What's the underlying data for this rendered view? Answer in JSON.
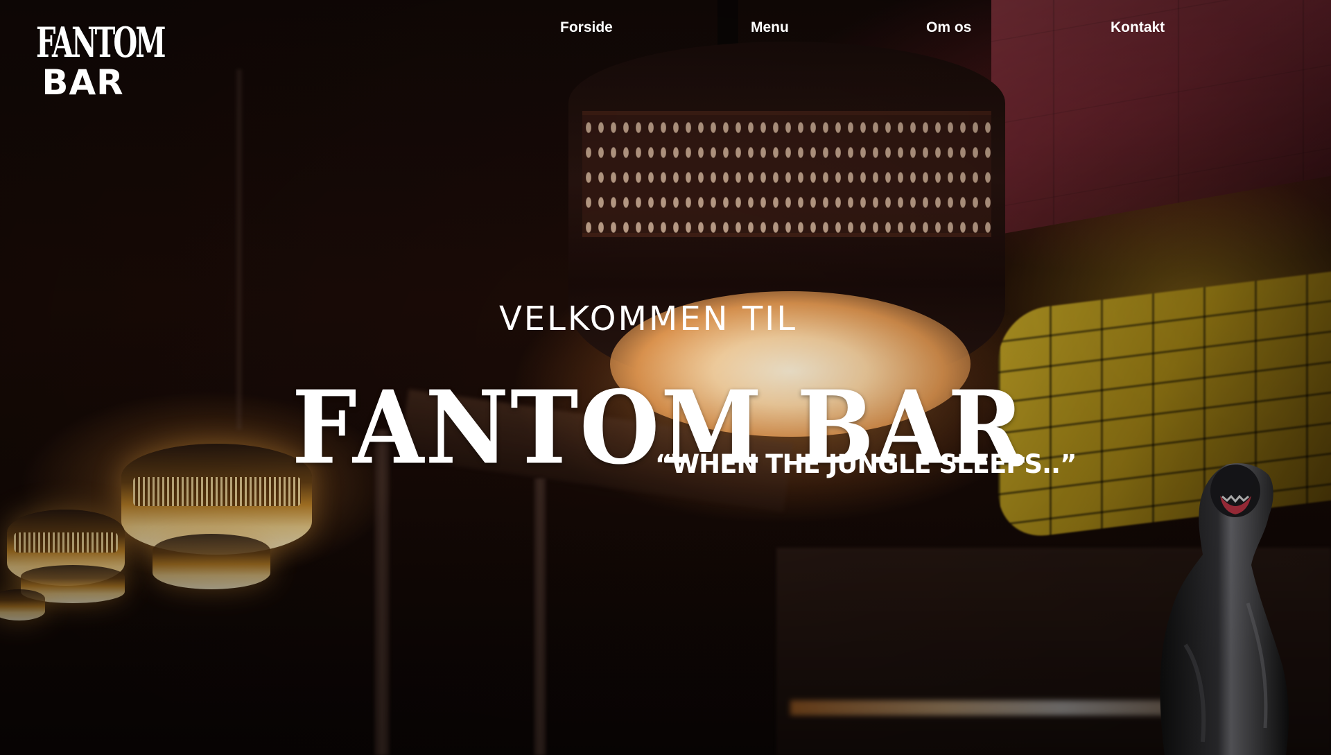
{
  "brand": {
    "logo_top": "FANTOM",
    "logo_bottom": "BAR"
  },
  "nav": {
    "items": [
      {
        "label": "Forside"
      },
      {
        "label": "Menu"
      },
      {
        "label": "Om os"
      },
      {
        "label": "Kontakt"
      }
    ]
  },
  "hero": {
    "subtitle": "VELKOMMEN TIL",
    "title": "FANTOM BAR",
    "tagline": "“WHEN THE JUNGLE SLEEPS..”"
  },
  "colors": {
    "text": "#ffffff",
    "background": "#140907",
    "lamp_glow": "#ffd9a6",
    "ceiling_red": "#9b3d49",
    "wall_yellow": "#d4b52a"
  }
}
